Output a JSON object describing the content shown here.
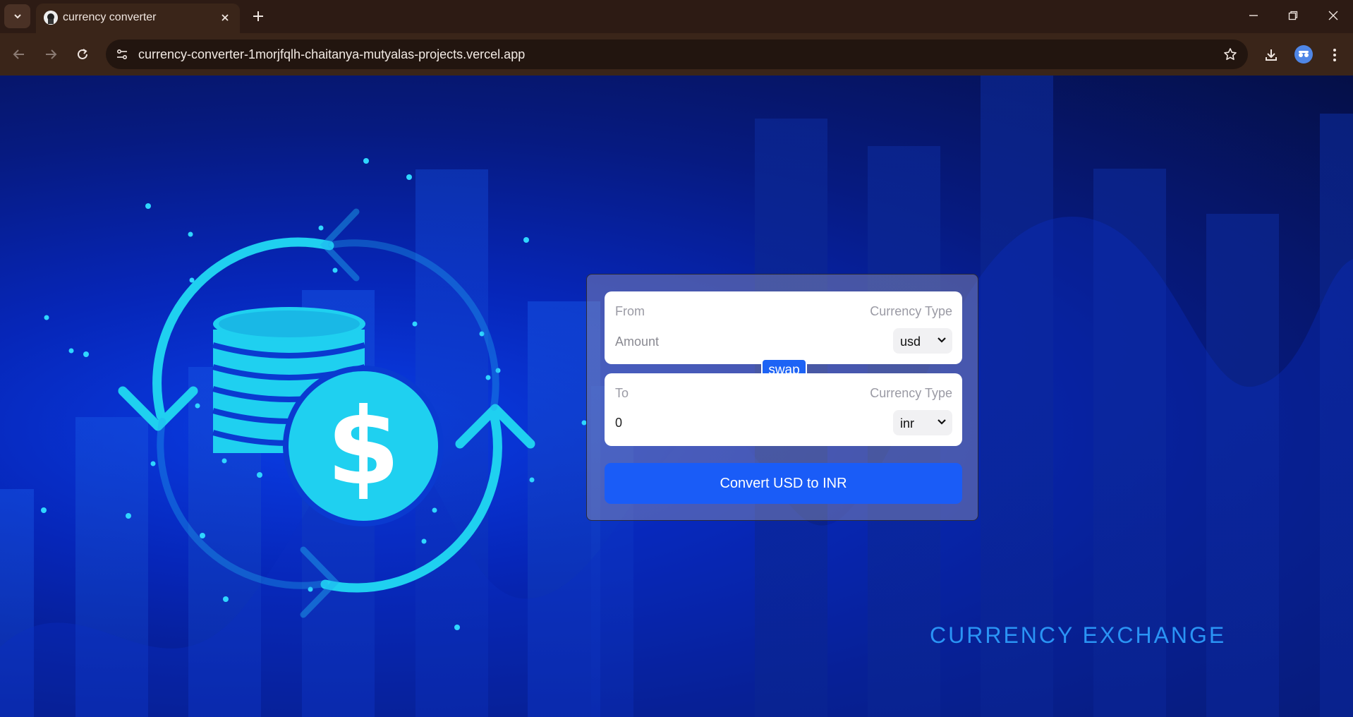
{
  "browser": {
    "tab_title": "currency converter",
    "url": "currency-converter-1morjfqlh-chaitanya-mutyalas-projects.vercel.app"
  },
  "converter": {
    "from": {
      "label": "From",
      "currency_type_label": "Currency Type",
      "amount_placeholder": "Amount",
      "currency": "usd"
    },
    "swap_label": "swap",
    "to": {
      "label": "To",
      "currency_type_label": "Currency Type",
      "amount": "0",
      "currency": "inr"
    },
    "convert_label": "Convert USD to INR"
  },
  "banner_text": "CURRENCY EXCHANGE",
  "colors": {
    "accent": "#1a5cf7",
    "page_bg": "#0626b8",
    "cyan": "#1fd0f0",
    "banner_text": "#2a94f5"
  }
}
